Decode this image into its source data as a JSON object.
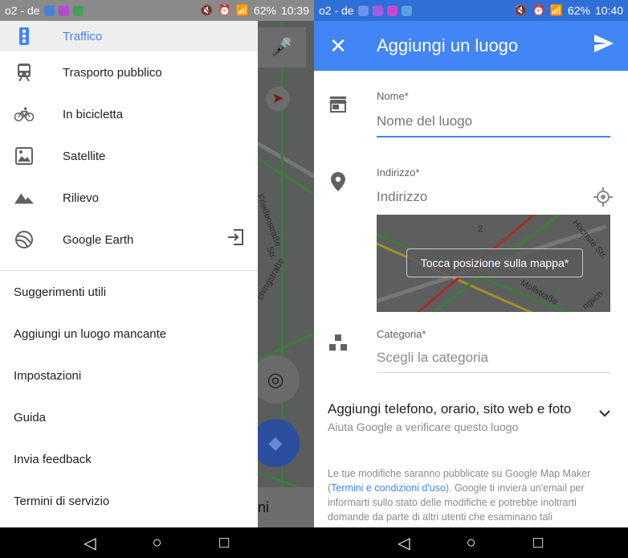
{
  "left": {
    "status": {
      "carrier": "o2 - de",
      "battery": "62%",
      "time": "10:39"
    },
    "drawer": {
      "layers": [
        {
          "label": "Traffico",
          "icon": "traffic-icon",
          "active": true
        },
        {
          "label": "Trasporto pubblico",
          "icon": "train-icon"
        },
        {
          "label": "In bicicletta",
          "icon": "bicycle-icon"
        },
        {
          "label": "Satellite",
          "icon": "satellite-image-icon"
        },
        {
          "label": "Rilievo",
          "icon": "terrain-icon"
        },
        {
          "label": "Google Earth",
          "icon": "google-earth-icon",
          "trailing_icon": "exit-app-icon"
        }
      ],
      "links": [
        "Suggerimenti utili",
        "Aggiungi un luogo mancante",
        "Impostazioni",
        "Guida",
        "Invia feedback",
        "Termini di servizio"
      ]
    },
    "map": {
      "street_1": "Friedenstraße",
      "street_2": "chingstraße",
      "street_3": "Str.",
      "bottom_text": "ni"
    }
  },
  "right": {
    "status": {
      "carrier": "o2 - de",
      "battery": "62%",
      "time": "10:40"
    },
    "appbar": {
      "title": "Aggiungi un luogo"
    },
    "form": {
      "name_label": "Nome*",
      "name_placeholder": "Nome del luogo",
      "address_label": "Indirizzo*",
      "address_placeholder": "Indirizzo",
      "map_hint": "Tocca posizione sulla mappa*",
      "map_street_1": "Höchste Str.",
      "map_street_2": "Mollstraße",
      "map_street_3": "ngsch",
      "map_number": "2",
      "category_label": "Categoria*",
      "category_placeholder": "Scegli la categoria"
    },
    "more": {
      "title": "Aggiungi telefono, orario, sito web e foto",
      "subtitle": "Aiuta Google a verificare questo luogo"
    },
    "legal": {
      "before": "Le tue modifiche saranno pubblicate su Google Map Maker (",
      "link": "Termini e condizioni d'uso",
      "after": "). Google ti invierà un'email per informarti sullo stato delle modifiche e potrebbe inoltrarti domande da parte di altri utenti che esaminano tali"
    }
  },
  "colors": {
    "primary": "#4285f4",
    "status_blue": "#2f6fd6"
  }
}
